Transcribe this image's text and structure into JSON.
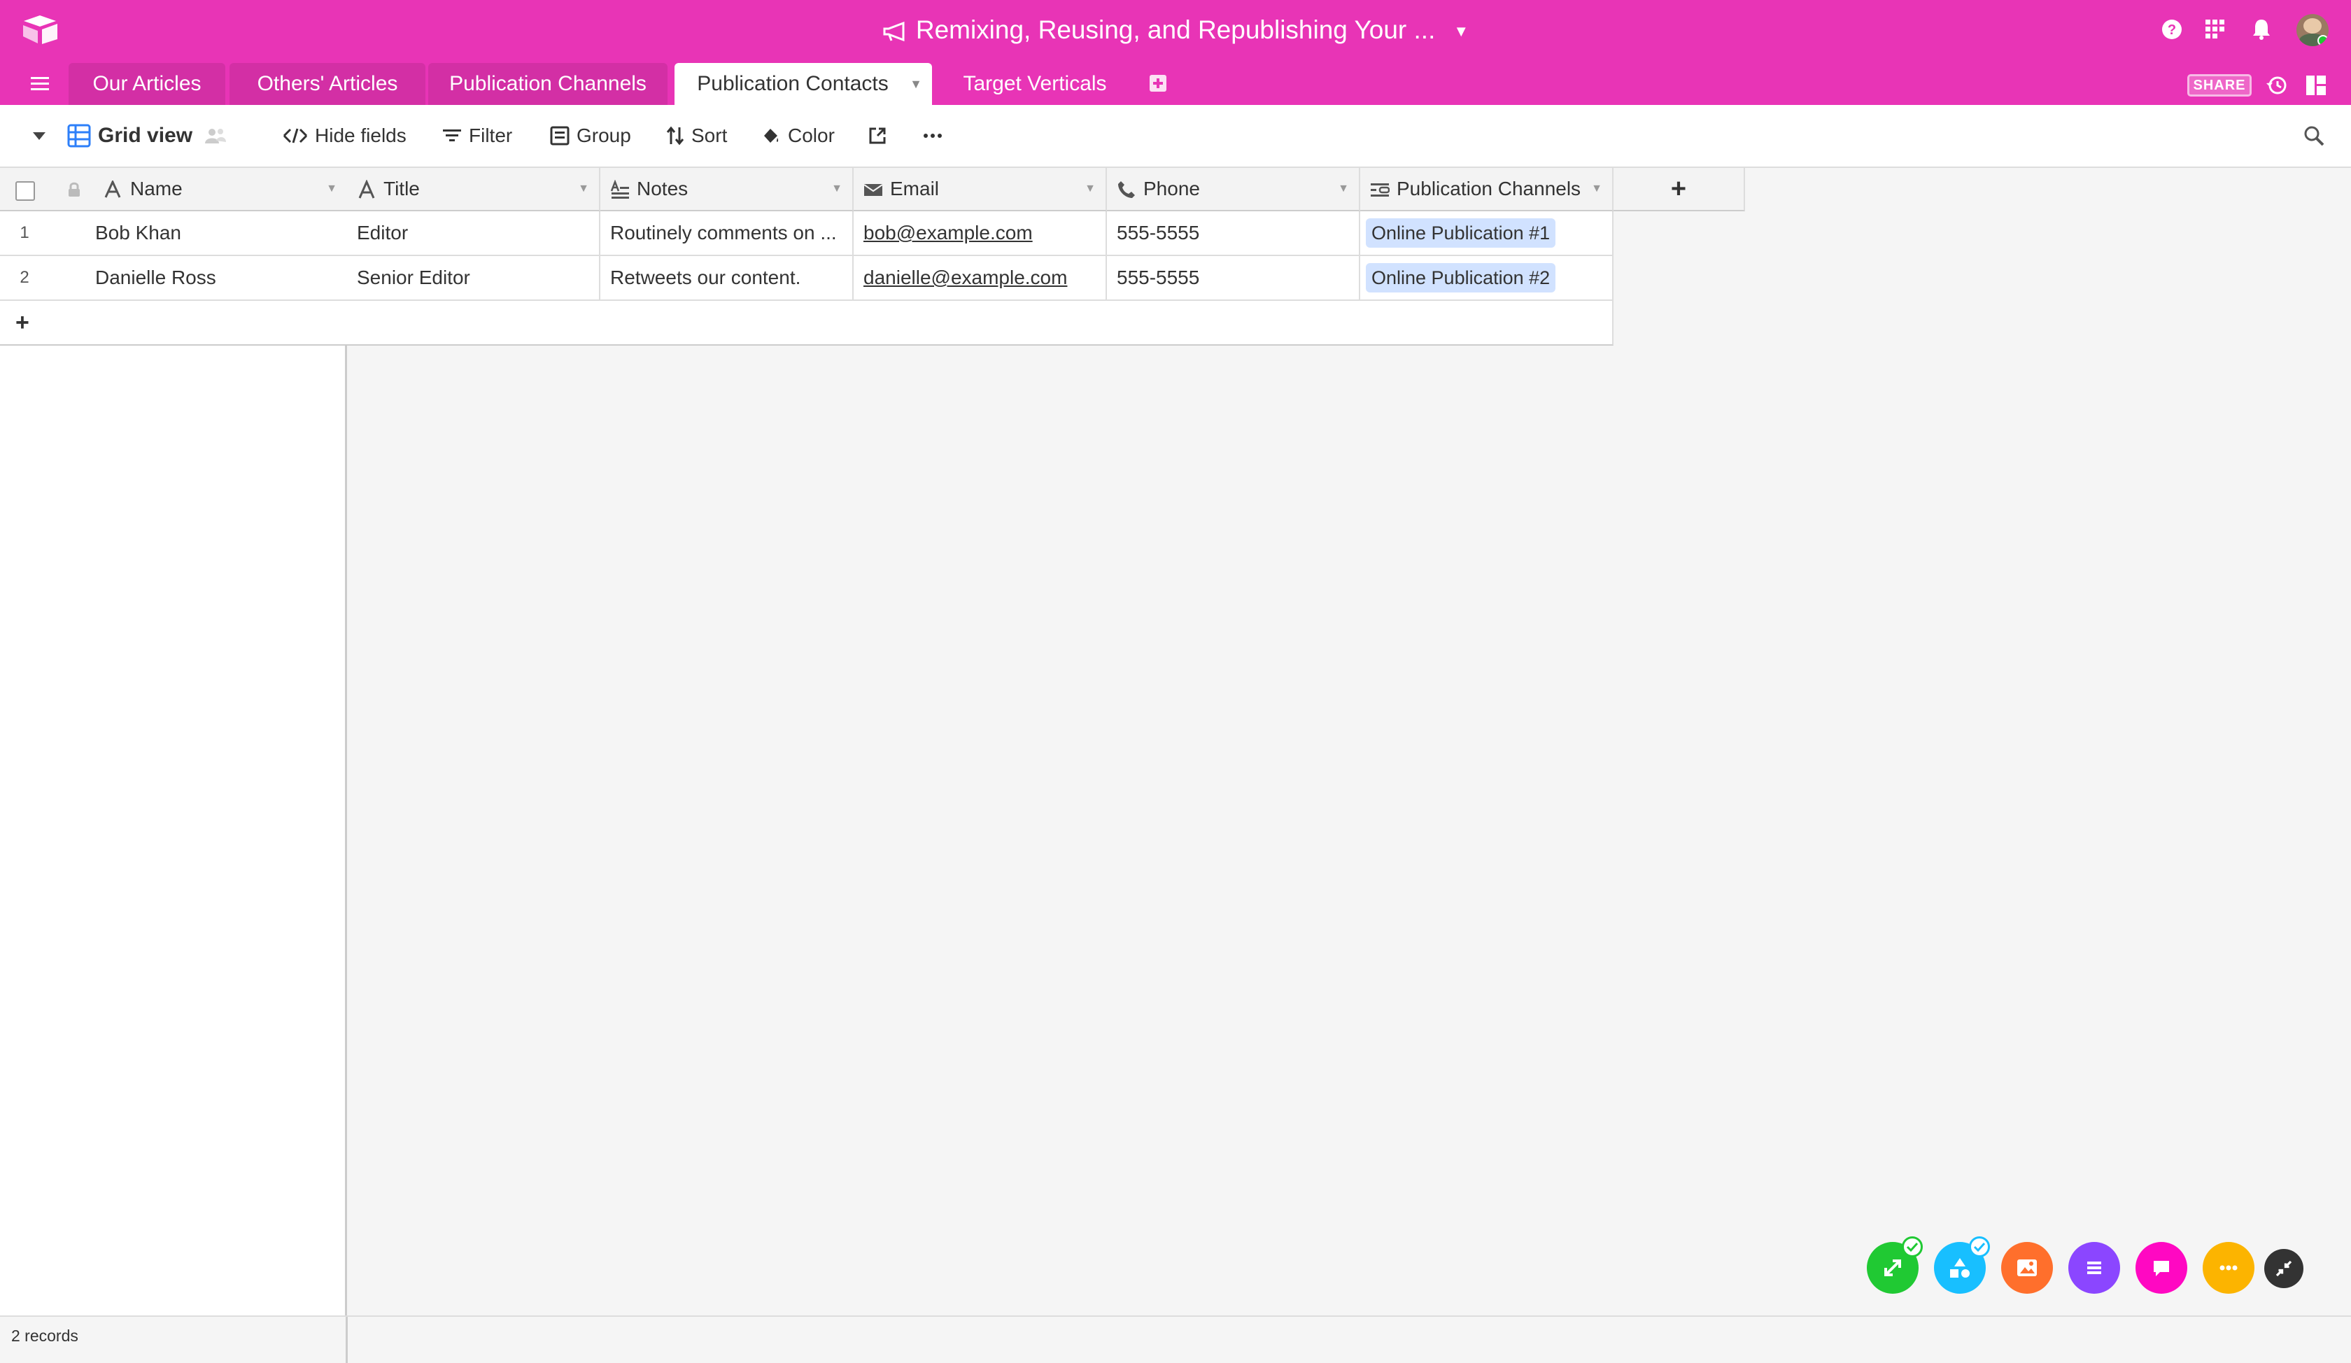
{
  "app": {
    "base_title": "Remixing, Reusing, and Republishing Your ...",
    "brand_color": "#e834b6"
  },
  "tabs": [
    {
      "label": "Our Articles"
    },
    {
      "label": "Others' Articles"
    },
    {
      "label": "Publication Channels"
    },
    {
      "label": "Publication Contacts",
      "active": true
    },
    {
      "label": "Target Verticals"
    }
  ],
  "header": {
    "share_label": "SHARE"
  },
  "viewbar": {
    "view_name": "Grid view",
    "hide_fields": "Hide fields",
    "filter": "Filter",
    "group": "Group",
    "sort": "Sort",
    "color": "Color"
  },
  "columns": [
    {
      "label": "Name",
      "icon": "text-icon"
    },
    {
      "label": "Title",
      "icon": "text-icon"
    },
    {
      "label": "Notes",
      "icon": "long-text-icon"
    },
    {
      "label": "Email",
      "icon": "email-icon"
    },
    {
      "label": "Phone",
      "icon": "phone-icon"
    },
    {
      "label": "Publication Channels",
      "icon": "link-icon"
    }
  ],
  "rows": [
    {
      "num": "1",
      "name": "Bob Khan",
      "title": "Editor",
      "notes": "Routinely comments on ...",
      "email": "bob@example.com",
      "phone": "555-5555",
      "channel": "Online Publication #1"
    },
    {
      "num": "2",
      "name": "Danielle Ross",
      "title": "Senior Editor",
      "notes": "Retweets our content.",
      "email": "danielle@example.com",
      "phone": "555-5555",
      "channel": "Online Publication #2"
    }
  ],
  "add_row": "+",
  "add_column": "+",
  "footer": {
    "record_count": "2 records"
  },
  "blocks": [
    {
      "name": "expand-block",
      "color": "#20c933"
    },
    {
      "name": "shapes-block",
      "color": "#18bfff"
    },
    {
      "name": "image-block",
      "color": "#ff6f2c"
    },
    {
      "name": "list-block",
      "color": "#8b46ff"
    },
    {
      "name": "chat-block",
      "color": "#ff08c2"
    },
    {
      "name": "more-block",
      "color": "#fcb400"
    },
    {
      "name": "collapse-block",
      "color": "#333333"
    }
  ]
}
